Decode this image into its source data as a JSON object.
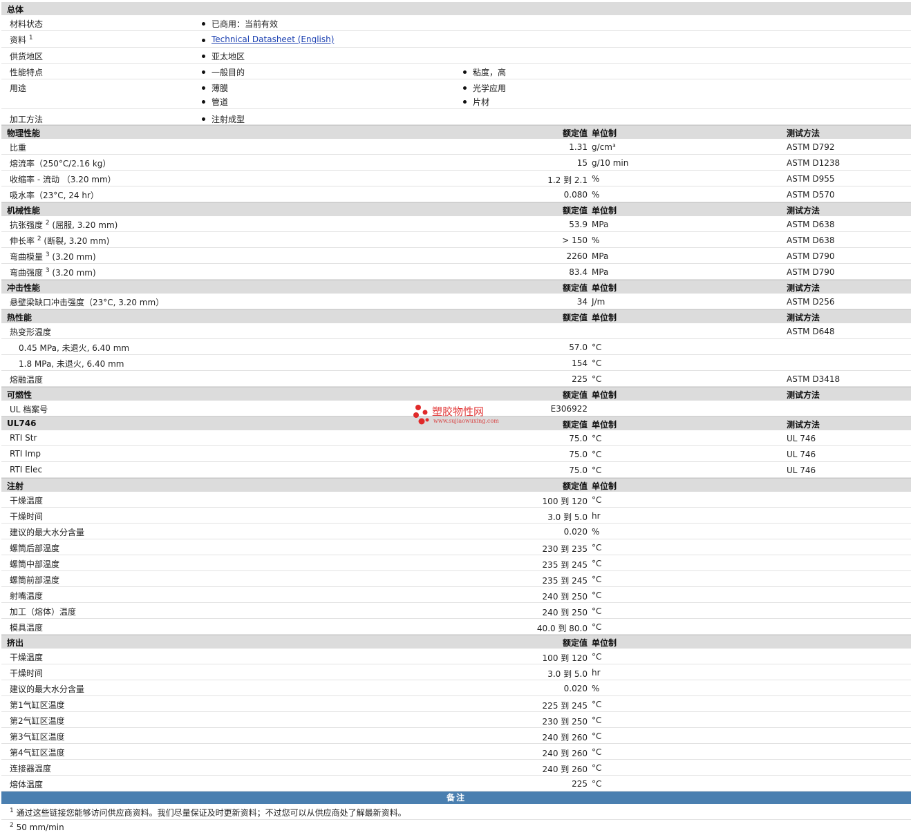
{
  "general": {
    "title": "总体",
    "status_label": "材料状态",
    "status_value": "已商用：当前有效",
    "docs_label": "资料",
    "docs_sup": "1",
    "docs_link": "Technical Datasheet (English)",
    "region_label": "供货地区",
    "region_value": "亚太地区",
    "features_label": "性能特点",
    "features": [
      "一般目的",
      "粘度，高"
    ],
    "uses_label": "用途",
    "uses": [
      "薄膜",
      "光学应用",
      "管道",
      "片材"
    ],
    "process_label": "加工方法",
    "process_value": "注射成型"
  },
  "headers": {
    "value": "额定值",
    "unit": "单位制",
    "method": "测试方法"
  },
  "physical": {
    "title": "物理性能",
    "rows": [
      {
        "label": "比重",
        "value": "1.31",
        "unit": "g/cm³",
        "method": "ASTM D792"
      },
      {
        "label": "熔流率（250°C/2.16 kg）",
        "value": "15",
        "unit": "g/10 min",
        "method": "ASTM D1238"
      },
      {
        "label": "收缩率 - 流动 （3.20 mm）",
        "value": "1.2 到 2.1",
        "unit": "%",
        "method": "ASTM D955"
      },
      {
        "label": "吸水率（23°C, 24 hr）",
        "value": "0.080",
        "unit": "%",
        "method": "ASTM D570"
      }
    ]
  },
  "mechanical": {
    "title": "机械性能",
    "rows": [
      {
        "label": "抗张强度",
        "sup": "2",
        "cond": "(屈服, 3.20 mm)",
        "value": "53.9",
        "unit": "MPa",
        "method": "ASTM D638"
      },
      {
        "label": "伸长率",
        "sup": "2",
        "cond": "(断裂, 3.20 mm)",
        "value": "> 150",
        "unit": "%",
        "method": "ASTM D638"
      },
      {
        "label": "弯曲模量",
        "sup": "3",
        "cond": "(3.20 mm)",
        "value": "2260",
        "unit": "MPa",
        "method": "ASTM D790"
      },
      {
        "label": "弯曲强度",
        "sup": "3",
        "cond": "(3.20 mm)",
        "value": "83.4",
        "unit": "MPa",
        "method": "ASTM D790"
      }
    ]
  },
  "impact": {
    "title": "冲击性能",
    "rows": [
      {
        "label": "悬壁梁缺口冲击强度（23°C, 3.20 mm）",
        "value": "34",
        "unit": "J/m",
        "method": "ASTM D256"
      }
    ]
  },
  "thermal": {
    "title": "热性能",
    "rows": [
      {
        "label": "热变形温度",
        "value": "",
        "unit": "",
        "method": "ASTM D648",
        "indent": false
      },
      {
        "label": "0.45 MPa, 未退火, 6.40 mm",
        "value": "57.0",
        "unit": "°C",
        "method": "",
        "indent": true
      },
      {
        "label": "1.8 MPa, 未退火, 6.40 mm",
        "value": "154",
        "unit": "°C",
        "method": "",
        "indent": true
      },
      {
        "label": "熔融温度",
        "value": "225",
        "unit": "°C",
        "method": "ASTM D3418",
        "indent": false
      }
    ]
  },
  "flammability": {
    "title": "可燃性",
    "rows": [
      {
        "label": "UL 档案号",
        "value": "E306922",
        "unit": "",
        "method": ""
      }
    ]
  },
  "ul746": {
    "title": "UL746",
    "rows": [
      {
        "label": "RTI Str",
        "value": "75.0",
        "unit": "°C",
        "method": "UL 746"
      },
      {
        "label": "RTI Imp",
        "value": "75.0",
        "unit": "°C",
        "method": "UL 746"
      },
      {
        "label": "RTI Elec",
        "value": "75.0",
        "unit": "°C",
        "method": "UL 746"
      }
    ]
  },
  "injection": {
    "title": "注射",
    "rows": [
      {
        "label": "干燥温度",
        "value": "100 到 120",
        "unit": "°C"
      },
      {
        "label": "干燥时间",
        "value": "3.0 到 5.0",
        "unit": "hr"
      },
      {
        "label": "建议的最大水分含量",
        "value": "0.020",
        "unit": "%"
      },
      {
        "label": "螺筒后部温度",
        "value": "230 到 235",
        "unit": "°C"
      },
      {
        "label": "螺筒中部温度",
        "value": "235 到 245",
        "unit": "°C"
      },
      {
        "label": "螺筒前部温度",
        "value": "235 到 245",
        "unit": "°C"
      },
      {
        "label": "射嘴温度",
        "value": "240 到 250",
        "unit": "°C"
      },
      {
        "label": "加工（熔体）温度",
        "value": "240 到 250",
        "unit": "°C"
      },
      {
        "label": "模具温度",
        "value": "40.0 到 80.0",
        "unit": "°C"
      }
    ]
  },
  "extrusion": {
    "title": "挤出",
    "rows": [
      {
        "label": "干燥温度",
        "value": "100 到 120",
        "unit": "°C"
      },
      {
        "label": "干燥时间",
        "value": "3.0 到 5.0",
        "unit": "hr"
      },
      {
        "label": "建议的最大水分含量",
        "value": "0.020",
        "unit": "%"
      },
      {
        "label": "第1气缸区温度",
        "value": "225 到 245",
        "unit": "°C"
      },
      {
        "label": "第2气缸区温度",
        "value": "230 到 250",
        "unit": "°C"
      },
      {
        "label": "第3气缸区温度",
        "value": "240 到 260",
        "unit": "°C"
      },
      {
        "label": "第4气缸区温度",
        "value": "240 到 260",
        "unit": "°C"
      },
      {
        "label": "连接器温度",
        "value": "240 到 260",
        "unit": "°C"
      },
      {
        "label": "熔体温度",
        "value": "225",
        "unit": "°C"
      }
    ]
  },
  "notes": {
    "title": "备注",
    "items": [
      {
        "num": "1",
        "text": "通过这些链接您能够访问供应商资料。我们尽量保证及时更新资料；不过您可以从供应商处了解最新资料。"
      },
      {
        "num": "2",
        "text": "50 mm/min"
      }
    ]
  },
  "watermark": {
    "text": "塑胶物性网",
    "url": "www.sujiaowuxing.com"
  }
}
